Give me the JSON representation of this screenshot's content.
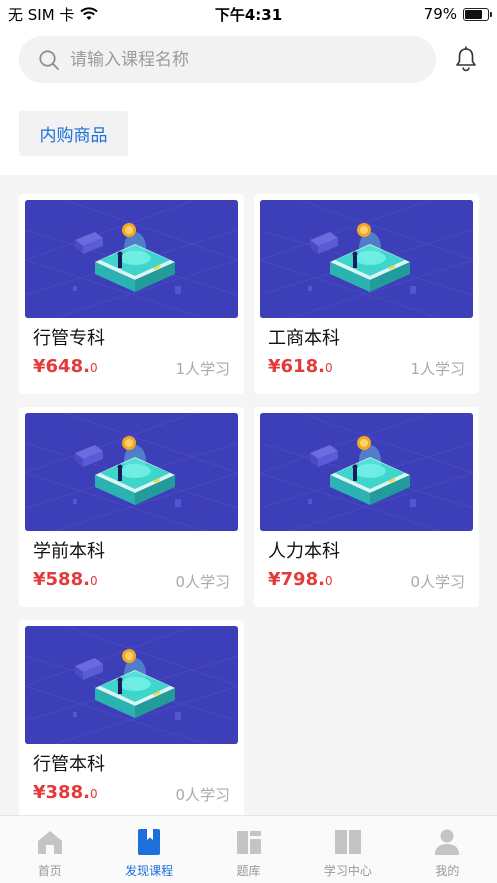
{
  "status_bar": {
    "carrier": "无 SIM 卡",
    "time": "下午4:31",
    "battery_percent": "79%",
    "battery_level": 0.79
  },
  "search": {
    "placeholder": "请输入课程名称"
  },
  "category": {
    "label": "内购商品"
  },
  "courses": [
    {
      "name": "行管专科",
      "price": "¥648.",
      "price_decimal": "0",
      "learners": "1人学习"
    },
    {
      "name": "工商本科",
      "price": "¥618.",
      "price_decimal": "0",
      "learners": "1人学习"
    },
    {
      "name": "学前本科",
      "price": "¥588.",
      "price_decimal": "0",
      "learners": "0人学习"
    },
    {
      "name": "人力本科",
      "price": "¥798.",
      "price_decimal": "0",
      "learners": "0人学习"
    },
    {
      "name": "行管本科",
      "price": "¥388.",
      "price_decimal": "0",
      "learners": "0人学习"
    }
  ],
  "tabs": [
    {
      "label": "首页",
      "icon": "home-icon",
      "active": false
    },
    {
      "label": "发现课程",
      "icon": "bookmark-book-icon",
      "active": true
    },
    {
      "label": "题库",
      "icon": "question-bank-icon",
      "active": false
    },
    {
      "label": "学习中心",
      "icon": "open-book-icon",
      "active": false
    },
    {
      "label": "我的",
      "icon": "person-icon",
      "active": false
    }
  ],
  "colors": {
    "accent": "#1e6fd9",
    "price": "#e33a3a",
    "thumb_bg": "#3d3fb8",
    "tab_inactive": "#c4c4c4"
  }
}
